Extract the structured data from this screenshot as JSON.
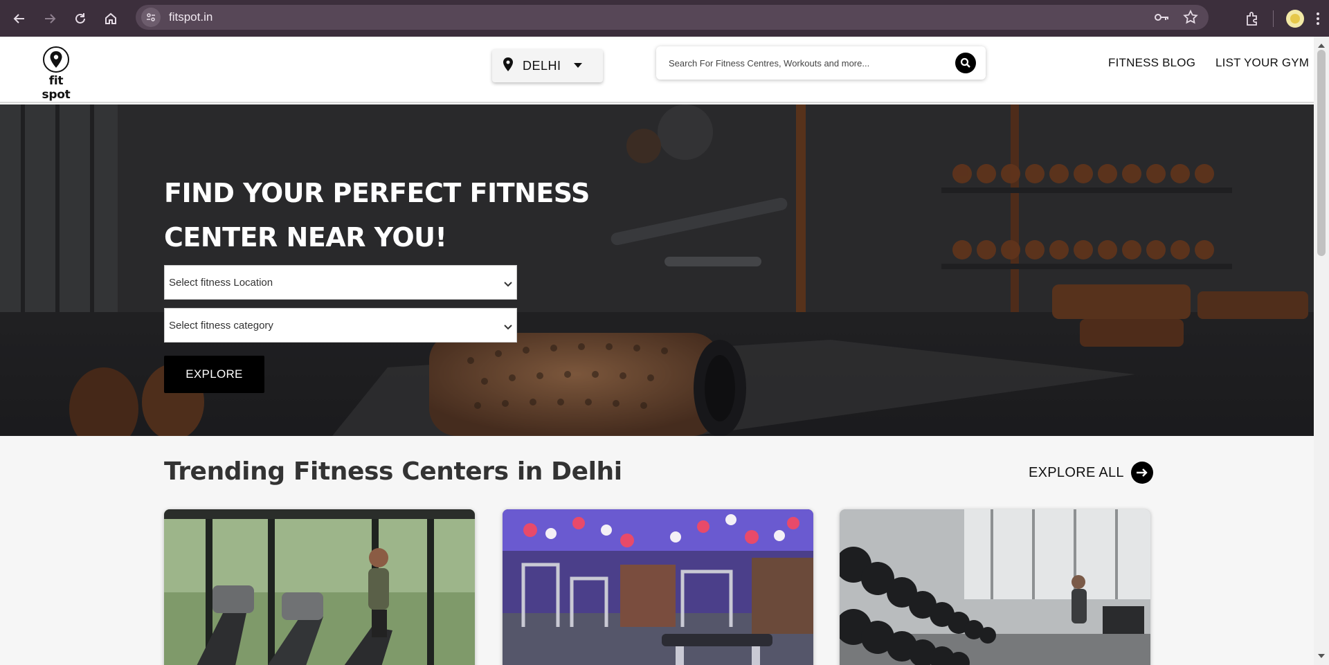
{
  "browser": {
    "url": "fitspot.in",
    "icons": [
      "back-arrow-icon",
      "forward-arrow-icon",
      "reload-icon",
      "home-icon",
      "site-info-icon",
      "password-key-icon",
      "bookmark-star-icon",
      "extensions-icon",
      "profile-avatar",
      "more-vert-icon"
    ]
  },
  "header": {
    "logo_text": "fit spot",
    "city": "DELHI",
    "search_placeholder": "Search For Fitness Centres, Workouts and more...",
    "nav": [
      "FITNESS BLOG",
      "LIST YOUR GYM"
    ]
  },
  "hero": {
    "title_line1": "FIND YOUR PERFECT FITNESS",
    "title_line2": "CENTER NEAR YOU!",
    "location_placeholder": "Select fitness Location",
    "category_placeholder": "Select fitness category",
    "explore_label": "EXPLORE"
  },
  "trending": {
    "title": "Trending Fitness Centers in Delhi",
    "explore_all_label": "EXPLORE ALL",
    "cards": [
      {
        "image": "treadmill-gym-photo"
      },
      {
        "image": "purple-lit-gym-photo"
      },
      {
        "image": "dumbbell-rack-gym-photo"
      }
    ]
  },
  "colors": {
    "chrome_bg": "#3c2f3c",
    "omnibox_bg": "#574757",
    "accent": "#000000",
    "page_bg": "#f6f6f6"
  }
}
